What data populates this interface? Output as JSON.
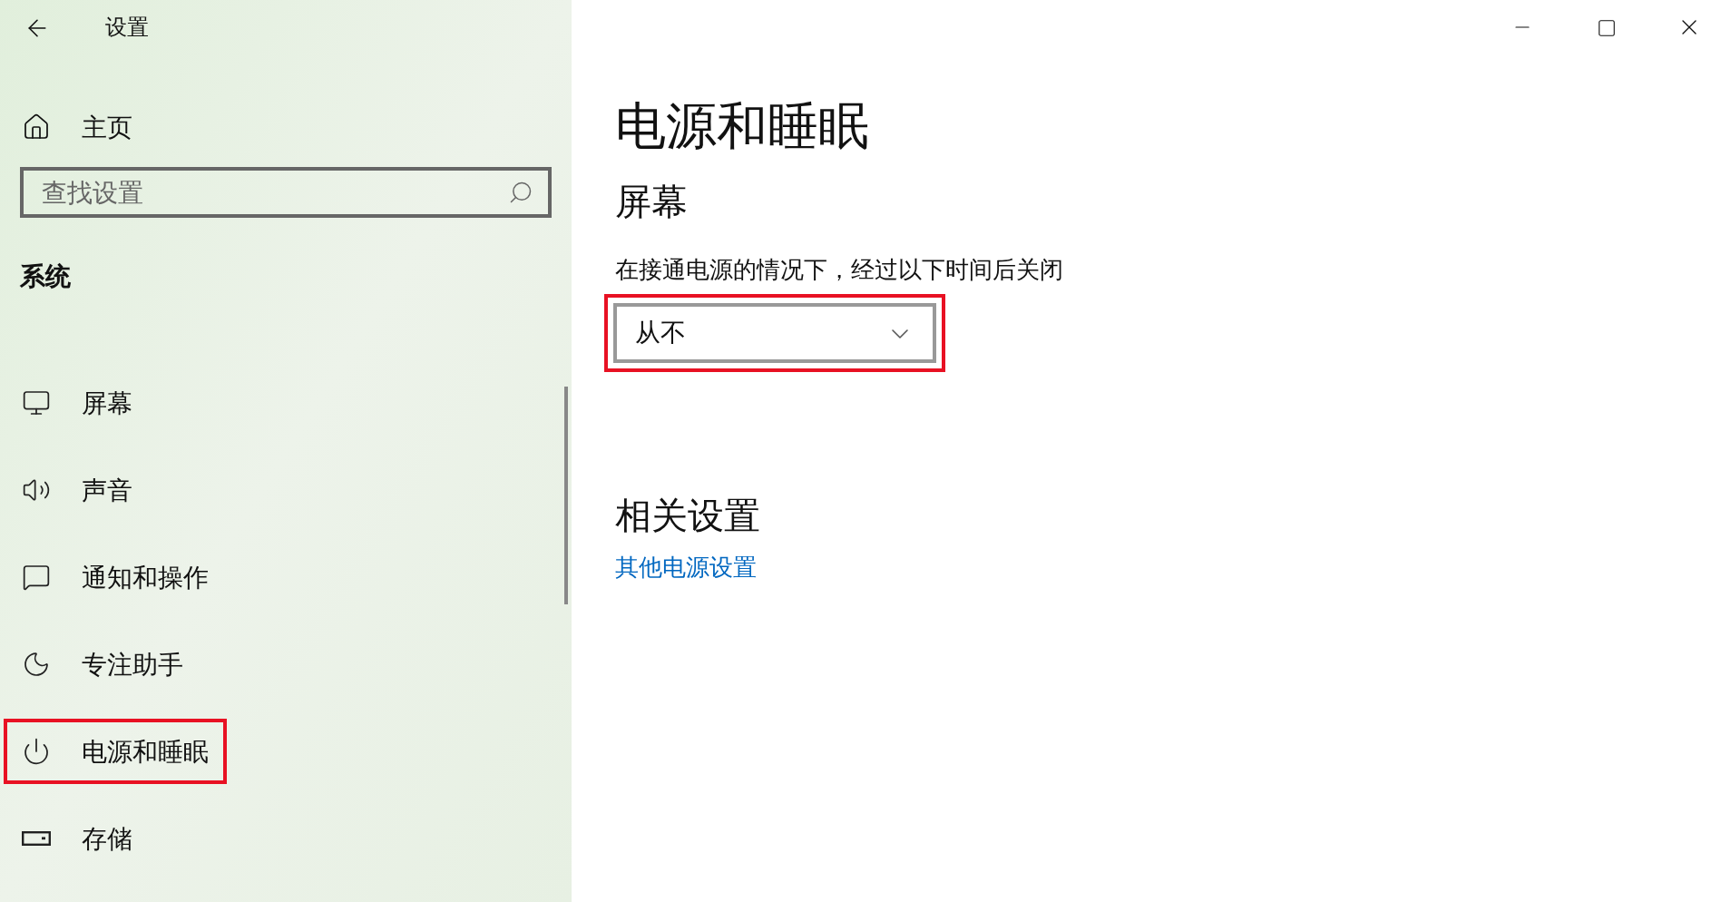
{
  "window": {
    "title": "设置"
  },
  "sidebar": {
    "home": "主页",
    "search": {
      "placeholder": "查找设置"
    },
    "section": "系统",
    "items": [
      {
        "label": "屏幕",
        "highlighted": false
      },
      {
        "label": "声音",
        "highlighted": false
      },
      {
        "label": "通知和操作",
        "highlighted": false
      },
      {
        "label": "专注助手",
        "highlighted": false
      },
      {
        "label": "电源和睡眠",
        "highlighted": true
      },
      {
        "label": "存储",
        "highlighted": false
      }
    ]
  },
  "main": {
    "title": "电源和睡眠",
    "section": "屏幕",
    "description": "在接通电源的情况下，经过以下时间后关闭",
    "dropdown": {
      "value": "从不",
      "highlighted": true
    },
    "related_title": "相关设置",
    "related_link": "其他电源设置"
  }
}
